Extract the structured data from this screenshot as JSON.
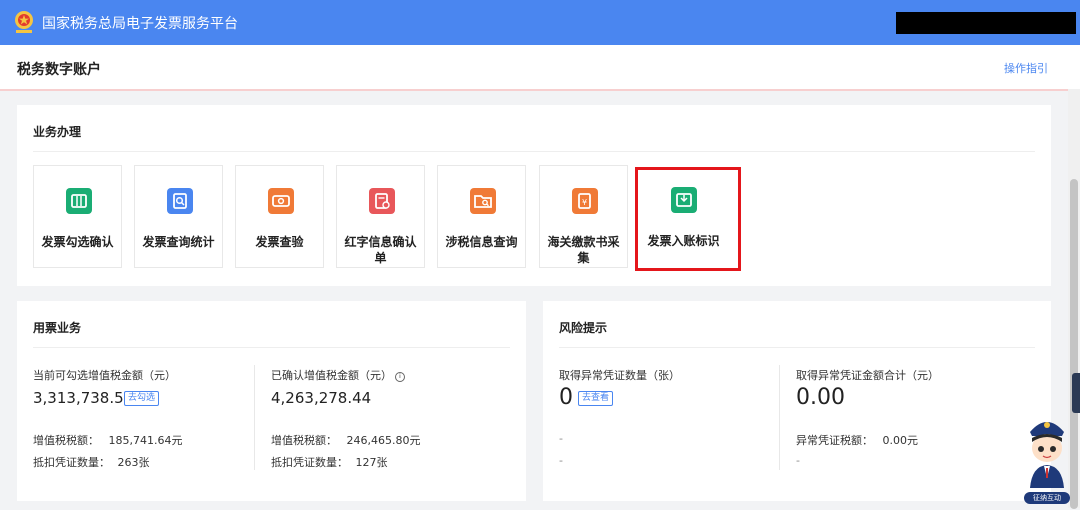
{
  "header": {
    "platform_title": "国家税务总局电子发票服务平台"
  },
  "subheader": {
    "page_title": "税务数字账户",
    "guide_link": "操作指引"
  },
  "business": {
    "title": "业务办理",
    "tiles": [
      {
        "label": "发票勾选确认",
        "icon": "ticket-icon",
        "color": "#1aad74"
      },
      {
        "label": "发票查询统计",
        "icon": "search-doc-icon",
        "color": "#4a86f0"
      },
      {
        "label": "发票查验",
        "icon": "ticket-check-icon",
        "color": "#f07a37"
      },
      {
        "label": "红字信息确认单",
        "icon": "red-doc-icon",
        "color": "#e8575a"
      },
      {
        "label": "涉税信息查询",
        "icon": "folder-search-icon",
        "color": "#f07a37"
      },
      {
        "label": "海关缴款书采集",
        "icon": "customs-doc-icon",
        "color": "#f07a37"
      },
      {
        "label": "发票入账标识",
        "icon": "inbox-icon",
        "color": "#1aad74"
      }
    ]
  },
  "usage": {
    "title": "用票业务",
    "left": {
      "label": "当前可勾选增值税金额（元）",
      "value": "3,313,738.54",
      "action": "去勾选",
      "tax_label": "增值税税额：",
      "tax_value": "185,741.64元",
      "count_label": "抵扣凭证数量：",
      "count_value": "263张"
    },
    "right": {
      "label": "已确认增值税金额（元）",
      "info": "i",
      "value": "4,263,278.44",
      "tax_label": "增值税税额：",
      "tax_value": "246,465.80元",
      "count_label": "抵扣凭证数量：",
      "count_value": "127张"
    }
  },
  "risk": {
    "title": "风险提示",
    "left": {
      "label": "取得异常凭证数量（张）",
      "value": "0",
      "action": "去查看",
      "line1": "-",
      "line2": "-"
    },
    "right": {
      "label": "取得异常凭证金额合计（元）",
      "value": "0.00",
      "tax_label": "异常凭证税额：",
      "tax_value": "0.00元",
      "line2": "-"
    }
  },
  "mascot": {
    "caption": "征纳互动"
  }
}
